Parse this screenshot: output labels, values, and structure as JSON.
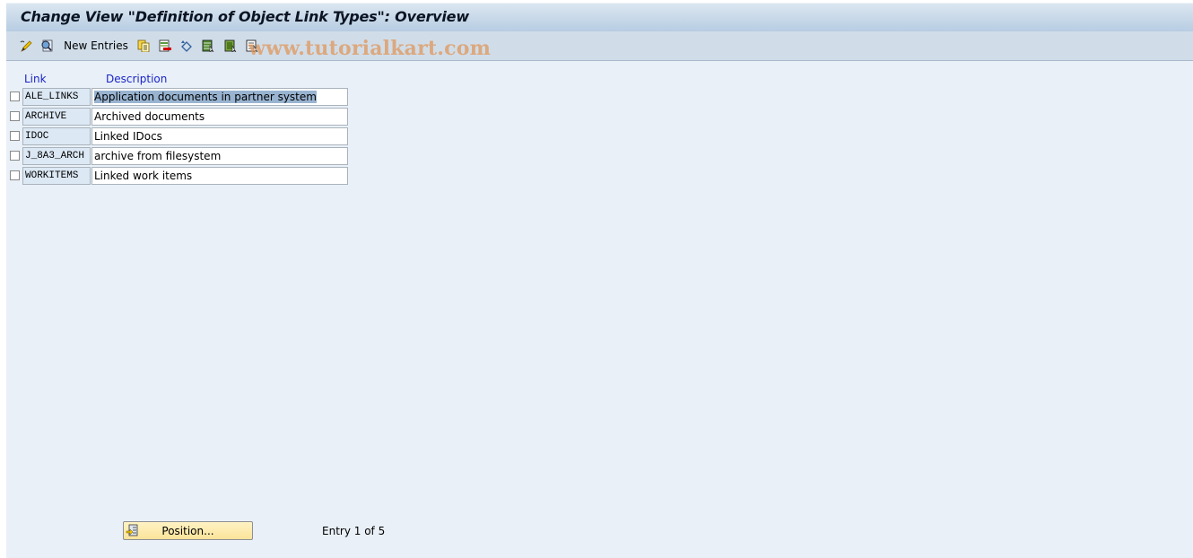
{
  "window": {
    "title": "Change View \"Definition of Object Link Types\": Overview"
  },
  "toolbar": {
    "items": [
      {
        "icon": "display-change-icon"
      },
      {
        "icon": "find-icon"
      },
      {
        "label": "New Entries"
      },
      {
        "icon": "copy-as-icon"
      },
      {
        "icon": "delete-icon"
      },
      {
        "icon": "undo-change-icon"
      },
      {
        "icon": "select-all-icon"
      },
      {
        "icon": "select-block-icon"
      },
      {
        "icon": "deselect-all-icon"
      }
    ],
    "watermark": "www.tutorialkart.com"
  },
  "table": {
    "columns": [
      "Link",
      "Description"
    ],
    "rows": [
      {
        "link": "ALE_LINKS",
        "description": "Application documents in partner system",
        "selected_text": true
      },
      {
        "link": "ARCHIVE",
        "description": "Archived documents"
      },
      {
        "link": "IDOC",
        "description": "Linked IDocs"
      },
      {
        "link": "J_8A3_ARCH",
        "description": "archive from filesystem"
      },
      {
        "link": "WORKITEMS",
        "description": "Linked work items"
      }
    ]
  },
  "footer": {
    "position_button": "Position...",
    "entry_status": "Entry 1 of 5"
  },
  "colors": {
    "column_header": "#1a24c8",
    "selection": "#99b4d1",
    "position_button": "#fbe39a"
  }
}
